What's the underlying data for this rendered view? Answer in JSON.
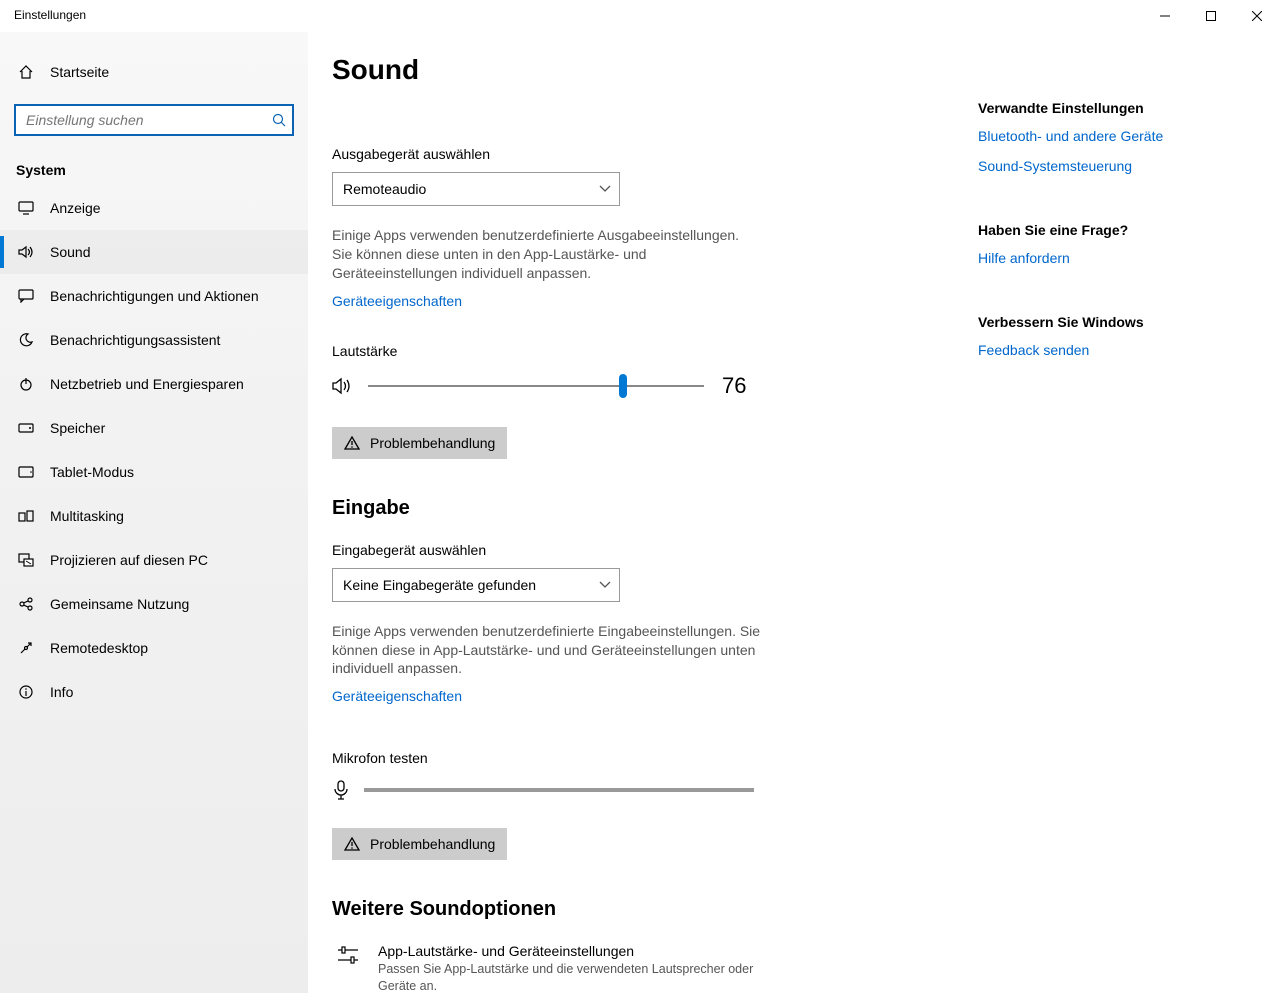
{
  "window": {
    "title": "Einstellungen"
  },
  "sidebar": {
    "home": "Startseite",
    "search_placeholder": "Einstellung suchen",
    "section": "System",
    "items": [
      {
        "label": "Anzeige"
      },
      {
        "label": "Sound"
      },
      {
        "label": "Benachrichtigungen und Aktionen"
      },
      {
        "label": "Benachrichtigungsassistent"
      },
      {
        "label": "Netzbetrieb und Energiesparen"
      },
      {
        "label": "Speicher"
      },
      {
        "label": "Tablet-Modus"
      },
      {
        "label": "Multitasking"
      },
      {
        "label": "Projizieren auf diesen PC"
      },
      {
        "label": "Gemeinsame Nutzung"
      },
      {
        "label": "Remotedesktop"
      },
      {
        "label": "Info"
      }
    ]
  },
  "page": {
    "title": "Sound",
    "output": {
      "choose_label": "Ausgabegerät auswählen",
      "selected": "Remoteaudio",
      "desc": "Einige Apps verwenden benutzerdefinierte Ausgabeeinstellungen. Sie können diese unten in den App-Laustärke- und Geräteeinstellungen individuell anpassen.",
      "props_link": "Geräteeigenschaften",
      "volume_label": "Lautstärke",
      "volume_value": "76",
      "troubleshoot": "Problembehandlung"
    },
    "input": {
      "heading": "Eingabe",
      "choose_label": "Eingabegerät auswählen",
      "selected": "Keine Eingabegeräte gefunden",
      "desc": "Einige Apps verwenden benutzerdefinierte Eingabeeinstellungen. Sie können diese in App-Lautstärke- und und Geräteeinstellungen unten individuell anpassen.",
      "props_link": "Geräteeigenschaften",
      "mic_test": "Mikrofon testen",
      "troubleshoot": "Problembehandlung"
    },
    "more": {
      "heading": "Weitere Soundoptionen",
      "item_title": "App-Lautstärke- und Geräteeinstellungen",
      "item_desc": "Passen Sie App-Lautstärke und die verwendeten Lautsprecher oder Geräte an."
    }
  },
  "right": {
    "related_head": "Verwandte Einstellungen",
    "related_links": [
      "Bluetooth- und andere Geräte",
      "Sound-Systemsteuerung"
    ],
    "question_head": "Haben Sie eine Frage?",
    "help_link": "Hilfe anfordern",
    "improve_head": "Verbessern Sie Windows",
    "feedback_link": "Feedback senden"
  }
}
